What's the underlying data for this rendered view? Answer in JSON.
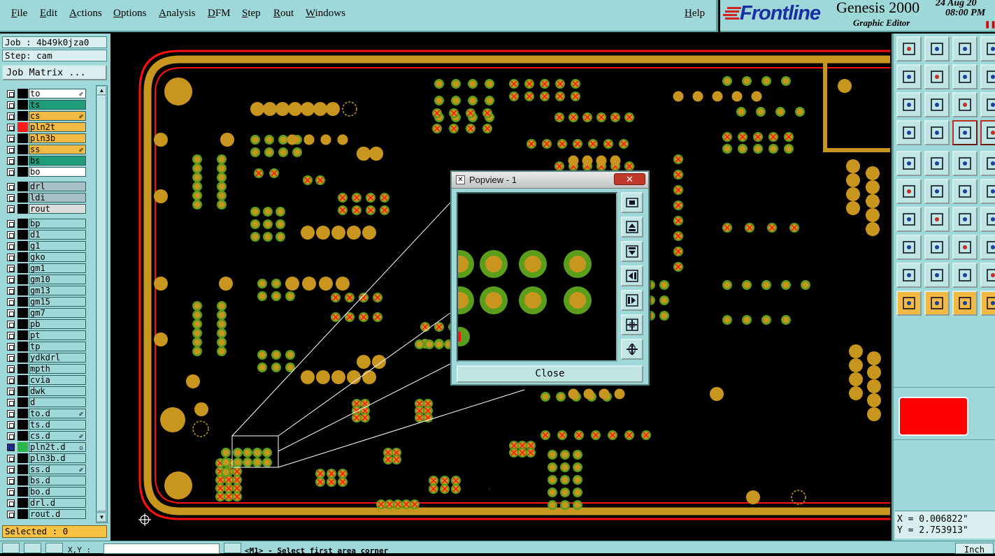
{
  "menu": {
    "items": [
      "File",
      "Edit",
      "Actions",
      "Options",
      "Analysis",
      "DFM",
      "Step",
      "Rout",
      "Windows"
    ],
    "help": "Help"
  },
  "brand": {
    "logo": "Frontline",
    "product": "Genesis 2000",
    "subtitle": "Graphic Editor",
    "date": "24 Aug 20",
    "time": "08:00 PM"
  },
  "left": {
    "job": "Job : 4b49k0jza0",
    "step": "Step: cam",
    "job_matrix": "Job Matrix ...",
    "selected": "Selected : 0"
  },
  "layers": [
    {
      "name": "to",
      "bg": "#ffffff",
      "swatch": "#000000",
      "icon": "✐"
    },
    {
      "name": "ts",
      "bg": "#1f9c7a",
      "swatch": "#000000",
      "icon": ""
    },
    {
      "name": "cs",
      "bg": "#f2b943",
      "swatch": "#000000",
      "icon": "✐"
    },
    {
      "name": "pln2t",
      "bg": "#f2b943",
      "swatch": "#ff1a1a",
      "icon": ""
    },
    {
      "name": "pln3b",
      "bg": "#f2b943",
      "swatch": "#000000",
      "icon": ""
    },
    {
      "name": "ss",
      "bg": "#f2b943",
      "swatch": "#000000",
      "icon": "✐"
    },
    {
      "name": "bs",
      "bg": "#1f9c7a",
      "swatch": "#000000",
      "icon": ""
    },
    {
      "name": "bo",
      "bg": "#ffffff",
      "swatch": "#000000",
      "icon": ""
    },
    {
      "name": "drl",
      "bg": "#a8c0c8",
      "swatch": "#000000",
      "icon": "",
      "gap": true
    },
    {
      "name": "ldi",
      "bg": "#a8c0c8",
      "swatch": "#000000",
      "icon": ""
    },
    {
      "name": "rout",
      "bg": "#dddddd",
      "swatch": "#000000",
      "icon": ""
    },
    {
      "name": "bp",
      "bg": "#9fd8d8",
      "swatch": "#000000",
      "icon": "",
      "gap": true
    },
    {
      "name": "d1",
      "bg": "#9fd8d8",
      "swatch": "#000000",
      "icon": ""
    },
    {
      "name": "g1",
      "bg": "#9fd8d8",
      "swatch": "#000000",
      "icon": ""
    },
    {
      "name": "gko",
      "bg": "#9fd8d8",
      "swatch": "#000000",
      "icon": ""
    },
    {
      "name": "gm1",
      "bg": "#9fd8d8",
      "swatch": "#000000",
      "icon": ""
    },
    {
      "name": "gm10",
      "bg": "#9fd8d8",
      "swatch": "#000000",
      "icon": ""
    },
    {
      "name": "gm13",
      "bg": "#9fd8d8",
      "swatch": "#000000",
      "icon": ""
    },
    {
      "name": "gm15",
      "bg": "#9fd8d8",
      "swatch": "#000000",
      "icon": ""
    },
    {
      "name": "gm7",
      "bg": "#9fd8d8",
      "swatch": "#000000",
      "icon": ""
    },
    {
      "name": "pb",
      "bg": "#9fd8d8",
      "swatch": "#000000",
      "icon": ""
    },
    {
      "name": "pt",
      "bg": "#9fd8d8",
      "swatch": "#000000",
      "icon": ""
    },
    {
      "name": "tp",
      "bg": "#9fd8d8",
      "swatch": "#000000",
      "icon": ""
    },
    {
      "name": "ydkdrl",
      "bg": "#9fd8d8",
      "swatch": "#000000",
      "icon": ""
    },
    {
      "name": "mpth",
      "bg": "#9fd8d8",
      "swatch": "#000000",
      "icon": ""
    },
    {
      "name": "cvia",
      "bg": "#9fd8d8",
      "swatch": "#000000",
      "icon": ""
    },
    {
      "name": "dwk",
      "bg": "#9fd8d8",
      "swatch": "#000000",
      "icon": ""
    },
    {
      "name": "d",
      "bg": "#9fd8d8",
      "swatch": "#000000",
      "icon": ""
    },
    {
      "name": "to.d",
      "bg": "#9fd8d8",
      "swatch": "#000000",
      "icon": "✐"
    },
    {
      "name": "ts.d",
      "bg": "#9fd8d8",
      "swatch": "#000000",
      "icon": ""
    },
    {
      "name": "cs.d",
      "bg": "#9fd8d8",
      "swatch": "#000000",
      "icon": "✐"
    },
    {
      "name": "pln2t.d",
      "bg": "#9fd8d8",
      "swatch": "#2db54a",
      "icon": "▫",
      "cbblue": true
    },
    {
      "name": "pln3b.d",
      "bg": "#9fd8d8",
      "swatch": "#000000",
      "icon": ""
    },
    {
      "name": "ss.d",
      "bg": "#9fd8d8",
      "swatch": "#000000",
      "icon": "✐"
    },
    {
      "name": "bs.d",
      "bg": "#9fd8d8",
      "swatch": "#000000",
      "icon": ""
    },
    {
      "name": "bo.d",
      "bg": "#9fd8d8",
      "swatch": "#000000",
      "icon": ""
    },
    {
      "name": "drl.d",
      "bg": "#9fd8d8",
      "swatch": "#000000",
      "icon": ""
    },
    {
      "name": "rout.d",
      "bg": "#9fd8d8",
      "swatch": "#000000",
      "icon": ""
    }
  ],
  "popview": {
    "title": "Popview - 1",
    "close_label": "Close"
  },
  "coords": {
    "x": "X = 0.006822\"",
    "y": "Y = 2.753913\""
  },
  "status": {
    "xy_label": "X,Y :",
    "message": "<M1> - Select first area corner",
    "units": "Inch"
  },
  "colors": {
    "pad": "#c8961e",
    "annular": "#5a9e1c",
    "outline_red": "#ff1010",
    "highlight": "#ff0000",
    "panel": "#9fd8d8"
  }
}
